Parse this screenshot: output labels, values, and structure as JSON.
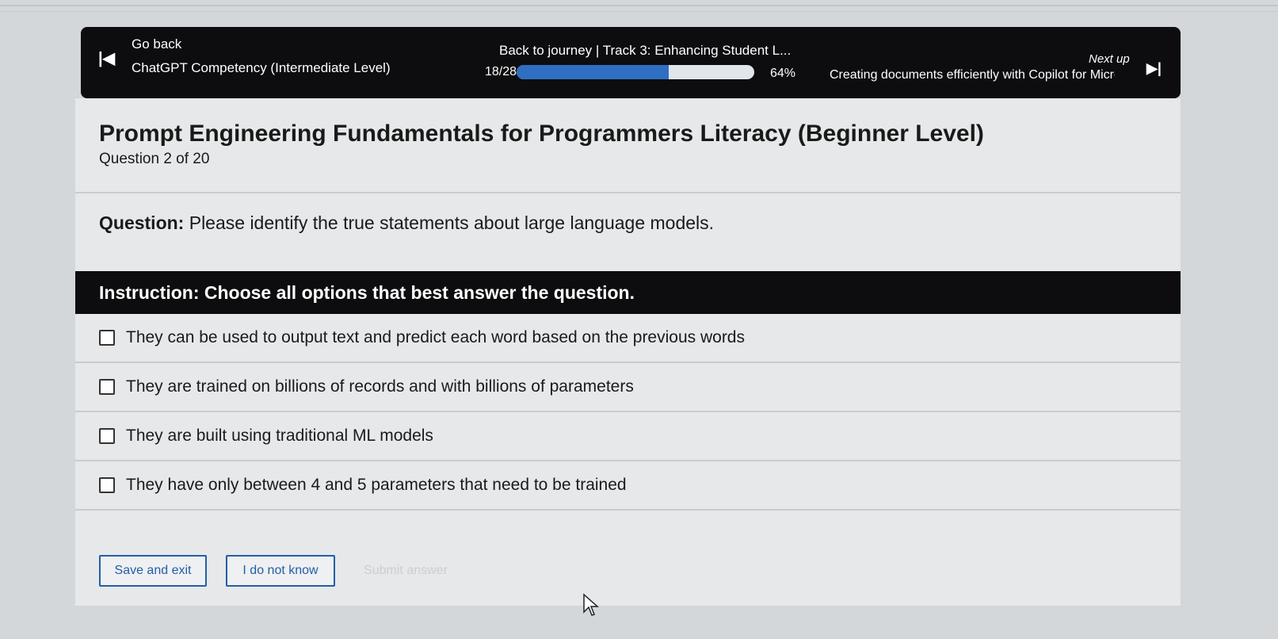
{
  "nav": {
    "go_back": "Go back",
    "course": "ChatGPT Competency (Intermediate Level)",
    "journey": "Back to journey  |  Track 3: Enhancing Student L...",
    "progress_count": "18/28",
    "progress_percent_label": "64%",
    "progress_fraction": 0.64,
    "next_up_label": "Next up",
    "next_item": "Creating documents efficiently with Copilot for Micro...",
    "prev_icon": "skip-previous-icon",
    "next_icon": "skip-next-icon"
  },
  "quiz": {
    "title": "Prompt Engineering Fundamentals for Programmers Literacy (Beginner Level)",
    "question_count": "Question 2 of 20",
    "question_label": "Question:",
    "question_text": " Please identify the true statements about large language models.",
    "instruction": "Instruction: Choose all options that best answer the question.",
    "options": [
      {
        "label": "They can be used to output text and predict each word based on the previous words",
        "checked": false
      },
      {
        "label": "They are trained on billions of records and with billions of parameters",
        "checked": false
      },
      {
        "label": "They are built using traditional ML models",
        "checked": false
      },
      {
        "label": "They have only between 4 and 5 parameters that need to be trained",
        "checked": false
      }
    ]
  },
  "actions": {
    "save_exit": "Save and exit",
    "dont_know": "I do not know",
    "submit": "Submit answer"
  },
  "colors": {
    "bar_bg": "#0d0d0f",
    "accent": "#225ea8",
    "progress_fill": "#2e6fc2"
  }
}
